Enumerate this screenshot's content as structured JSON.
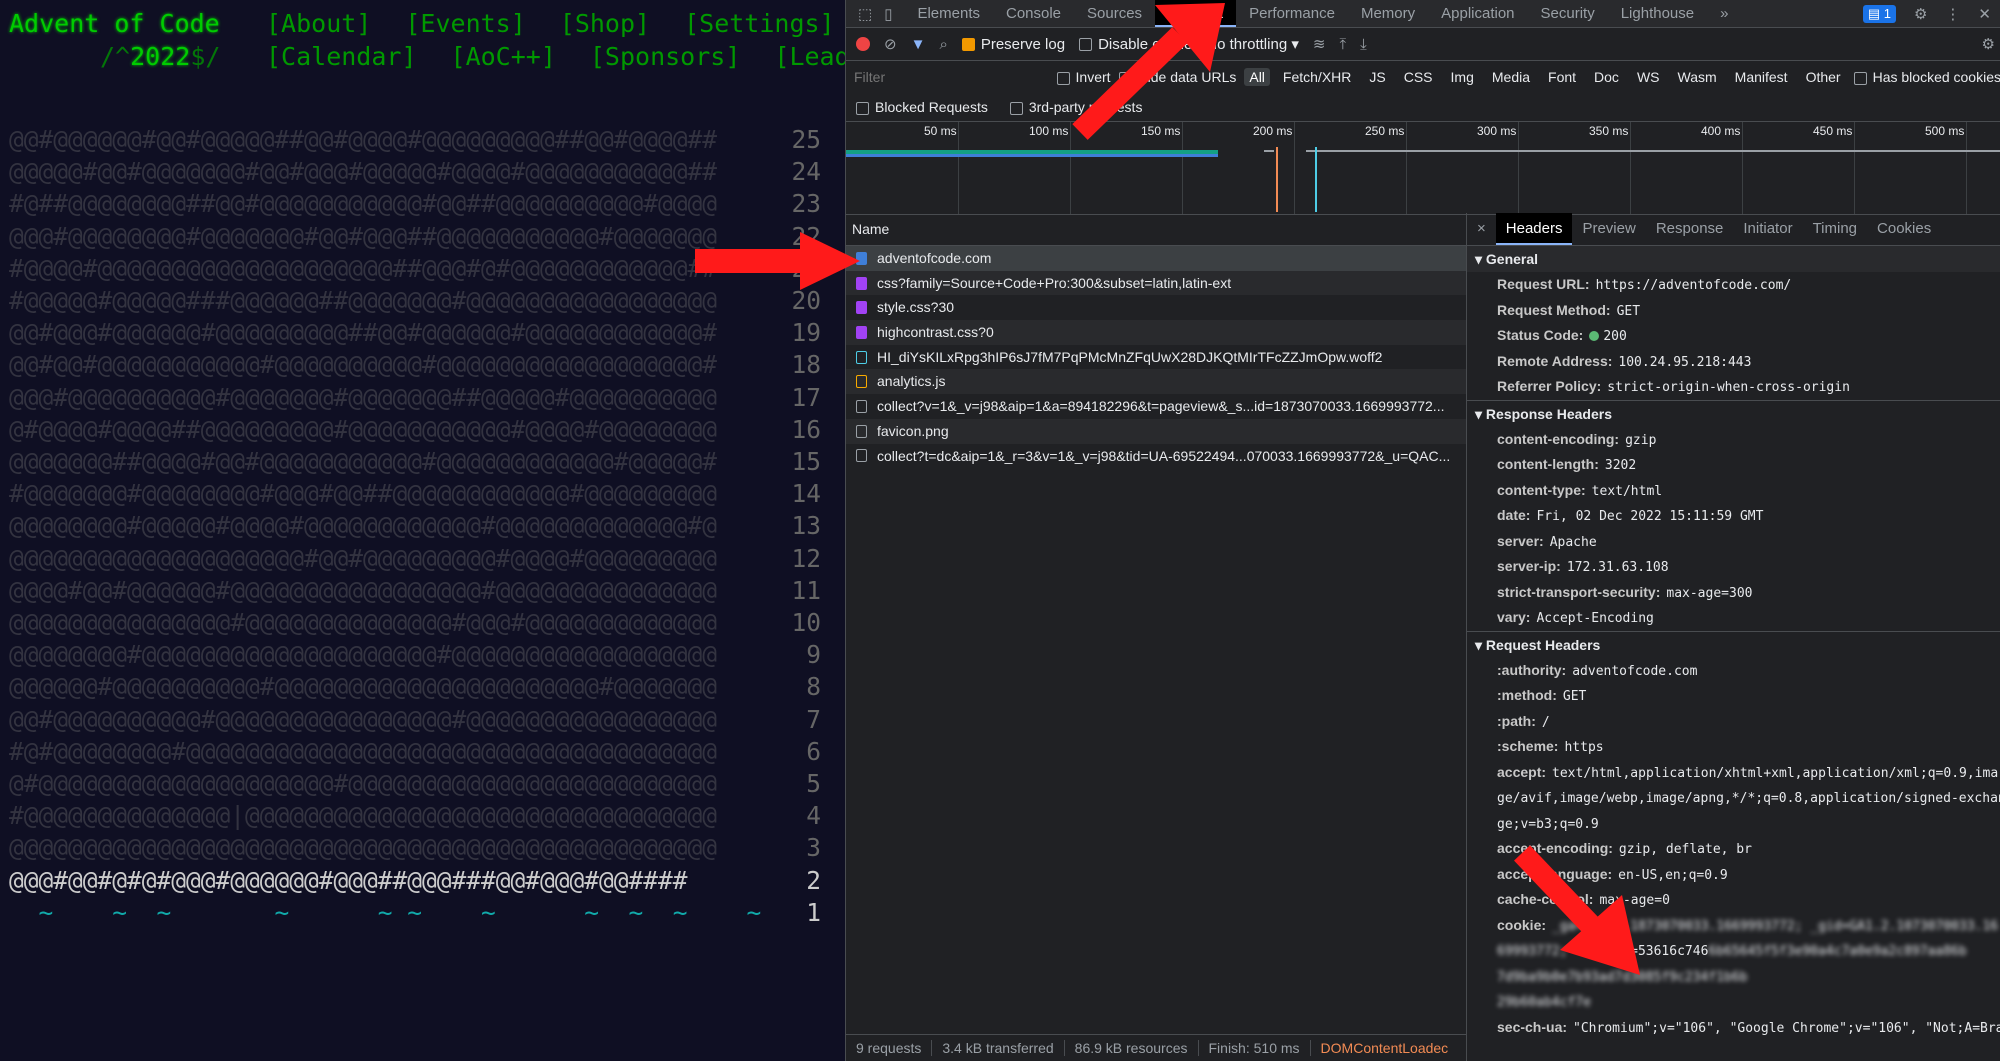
{
  "aoc": {
    "title": "Advent of Code",
    "year_prefix": "/^",
    "year": "2022",
    "year_suffix": "$/",
    "nav_row1": [
      "[About]",
      "[Events]",
      "[Shop]",
      "[Settings]"
    ],
    "nav_row2": [
      "[Calendar]",
      "[AoC++]",
      "[Sponsors]",
      "[Lead"
    ],
    "calendar": [
      {
        "art": "@@#@@@@@@#@@#@@@@@##@@#@@@@#@@@@@@@@@##@@#@@@@##",
        "day": "25",
        "lit": false
      },
      {
        "art": "@@@@@#@@#@@@@@@@#@@#@@@#@@@@@#@@@@#@@@@@@@@@@@##",
        "day": "24",
        "lit": false
      },
      {
        "art": "#@##@@@@@@@@##@@#@@@@@@@@@@@#@@##@@@@@@@@@@#@@@@",
        "day": "23",
        "lit": false
      },
      {
        "art": "@@@#@@@@@@@@#@@@@@@@#@@#@@@##@@@@@@@@@@@#@@@@@@@",
        "day": "22",
        "lit": false
      },
      {
        "art": "#@@@@#@@@@@@@@@@@@@@@@@@@@##@@@#@#@@@@@@@@@@@@##",
        "day": "21",
        "lit": false
      },
      {
        "art": "#@@@@@#@@@@@###@@@@@@##@@@@@@@#@@@@@@@@@@@@@@@@@",
        "day": "20",
        "lit": false
      },
      {
        "art": "@@#@@@#@@@@@@#@@@@@@@@@##@@#@@@@@@#@@@@@@@@@@@@#",
        "day": "19",
        "lit": false
      },
      {
        "art": "@@#@@#@@@@@@@@@@@#@@@@@@@@@@#@@@@@@@@@@@@@@@@@@#",
        "day": "18",
        "lit": false
      },
      {
        "art": "@@@#@@@@@@@@@@#@@@@@@@#@@@@@@@##@@@@@#@@@@@@@@@@",
        "day": "17",
        "lit": false
      },
      {
        "art": "@#@@@@#@@@@##@@@@@@@@@#@@@@@@@@@@@#@@@@#@@@@@@@@",
        "day": "16",
        "lit": false
      },
      {
        "art": "@@@@@@@##@@@@#@@#@@@@@@@@@@@#@@@@@@@@@@@@#@@@@@#",
        "day": "15",
        "lit": false
      },
      {
        "art": "#@@@@@@@#@@@@@@@@#@@@#@@##@@@@@@@@@@@@#@@@@@@@@@",
        "day": "14",
        "lit": false
      },
      {
        "art": "@@@@@@@@#@@@@@#@@@@#@@@@@@@@@@@@#@@@@@@@@@@@@@#@",
        "day": "13",
        "lit": false
      },
      {
        "art": "@@@@@@@@@@@@@@@@@@@@#@@#@@@@@@@@@#@@@@#@@@@@@@@@",
        "day": "12",
        "lit": false
      },
      {
        "art": "@@@@#@@#@@@@@@#@@@@@@@@@@@@@@@@@#@@@@@@@@@@@@@@@",
        "day": "11",
        "lit": false
      },
      {
        "art": "@@@@@@@@@@@@@@@#@@@@@@@@@@@@@@#@@@#@@@@@@@@@@@@@",
        "day": "10",
        "lit": false
      },
      {
        "art": "@@@@@@@@#@@@@@@@@@@@@@@@@@@@@#@@@@@@@@@@@@@@@@@@",
        "day": "9",
        "lit": false
      },
      {
        "art": "@@@@@@#@@@@@@@@@@#@@@@@@@@@@@@@@@@@@@@@@#@@@@@@@",
        "day": "8",
        "lit": false
      },
      {
        "art": "@@#@@@@@@@@@@#@@@@@@@@@@@@@@@@#@@@@@@@@@@@@@@@@@",
        "day": "7",
        "lit": false
      },
      {
        "art": "#@#@@@@@@@@#@@@@@@@@@@@@@@@@@@@@@@@@@@@@@@@@@@@@",
        "day": "6",
        "lit": false
      },
      {
        "art": "@#@@@@@@@@@@@@@@@@@@@@#@@@@@@@@@@@@@@@@@@@@@@@@@",
        "day": "5",
        "lit": false
      },
      {
        "art": "#@@@@@@@@@@@@@@|@@@@@@@@@@@@@@@@@@@@@@@@@@@@@@@@",
        "day": "4",
        "lit": false
      },
      {
        "art": "@@@@@@@@@@@@@@@@@@@@@@@@@@@@@@@@@@@@@@@@@@@@@@@@",
        "day": "3",
        "lit": false
      },
      {
        "art": "@@@#@@#@#@#@@@#@@@@@@#@@@##@@@###@@#@@@#@@####",
        "day": "2",
        "lit": true
      },
      {
        "art": "  ~    ~  ~       ~      ~ ~    ~      ~  ~  ~    ~",
        "day": "1",
        "lit": true,
        "waves": true
      }
    ]
  },
  "devtools": {
    "main_tabs": [
      "Elements",
      "Console",
      "Sources",
      "Network",
      "Performance",
      "Memory",
      "Application",
      "Security",
      "Lighthouse"
    ],
    "active_tab": "Network",
    "more_tabs": "»",
    "issues_count": "1",
    "toolbar": {
      "preserve_log": "Preserve log",
      "disable_cache": "Disable cache",
      "throttling": "No throttling"
    },
    "filter": {
      "placeholder": "Filter",
      "invert": "Invert",
      "hide_data_urls": "Hide data URLs",
      "types": [
        "All",
        "Fetch/XHR",
        "JS",
        "CSS",
        "Img",
        "Media",
        "Font",
        "Doc",
        "WS",
        "Wasm",
        "Manifest",
        "Other"
      ],
      "has_blocked_cookies": "Has blocked cookies",
      "blocked_requests": "Blocked Requests",
      "third_party": "3rd-party requests"
    },
    "timeline_ticks": [
      "50 ms",
      "100 ms",
      "150 ms",
      "200 ms",
      "250 ms",
      "300 ms",
      "350 ms",
      "400 ms",
      "450 ms",
      "500 ms"
    ],
    "list_header": "Name",
    "requests": [
      {
        "name": "adventofcode.com",
        "type": "doc"
      },
      {
        "name": "css?family=Source+Code+Pro:300&subset=latin,latin-ext",
        "type": "css"
      },
      {
        "name": "style.css?30",
        "type": "css"
      },
      {
        "name": "highcontrast.css?0",
        "type": "css"
      },
      {
        "name": "HI_diYsKILxRpg3hIP6sJ7fM7PqPMcMnZFqUwX28DJKQtMIrTFcZZJmOpw.woff2",
        "type": "font"
      },
      {
        "name": "analytics.js",
        "type": "js"
      },
      {
        "name": "collect?v=1&_v=j98&aip=1&a=894182296&t=pageview&_s...id=1873070033.1669993772...",
        "type": "other"
      },
      {
        "name": "favicon.png",
        "type": "other"
      },
      {
        "name": "collect?t=dc&aip=1&_r=3&v=1&_v=j98&tid=UA-69522494...070033.1669993772&_u=QAC...",
        "type": "other"
      }
    ],
    "status": {
      "requests": "9 requests",
      "transferred": "3.4 kB transferred",
      "resources": "86.9 kB resources",
      "finish": "Finish: 510 ms",
      "dcl": "DOMContentLoadec"
    },
    "detail_tabs": [
      "Headers",
      "Preview",
      "Response",
      "Initiator",
      "Timing",
      "Cookies"
    ],
    "detail_close": "×",
    "general": {
      "title": "General",
      "rows": [
        {
          "k": "Request URL:",
          "v": "https://adventofcode.com/"
        },
        {
          "k": "Request Method:",
          "v": "GET"
        },
        {
          "k": "Status Code:",
          "v": "200"
        },
        {
          "k": "Remote Address:",
          "v": "100.24.95.218:443"
        },
        {
          "k": "Referrer Policy:",
          "v": "strict-origin-when-cross-origin"
        }
      ]
    },
    "response_headers": {
      "title": "Response Headers",
      "rows": [
        {
          "k": "content-encoding:",
          "v": "gzip"
        },
        {
          "k": "content-length:",
          "v": "3202"
        },
        {
          "k": "content-type:",
          "v": "text/html"
        },
        {
          "k": "date:",
          "v": "Fri, 02 Dec 2022 15:11:59 GMT"
        },
        {
          "k": "server:",
          "v": "Apache"
        },
        {
          "k": "server-ip:",
          "v": "172.31.63.108"
        },
        {
          "k": "strict-transport-security:",
          "v": "max-age=300"
        },
        {
          "k": "vary:",
          "v": "Accept-Encoding"
        }
      ]
    },
    "request_headers": {
      "title": "Request Headers",
      "rows": [
        {
          "k": ":authority:",
          "v": "adventofcode.com"
        },
        {
          "k": ":method:",
          "v": "GET"
        },
        {
          "k": ":path:",
          "v": "/"
        },
        {
          "k": ":scheme:",
          "v": "https"
        },
        {
          "k": "accept:",
          "v": "text/html,application/xhtml+xml,application/xml;q=0.9,ima"
        },
        {
          "k": "",
          "v": "ge/avif,image/webp,image/apng,*/*;q=0.8,application/signed-exchan"
        },
        {
          "k": "",
          "v": "ge;v=b3;q=0.9"
        },
        {
          "k": "accept-encoding:",
          "v": "gzip, deflate, br"
        },
        {
          "k": "accept-language:",
          "v": "en-US,en;q=0.9"
        },
        {
          "k": "cache-control:",
          "v": "max-age=0"
        }
      ],
      "cookie_key": "cookie:",
      "session_value": "session=53616c746",
      "sec_ch_ua_key": "sec-ch-ua:",
      "sec_ch_ua_value": "\"Chromium\";v=\"106\", \"Google Chrome\";v=\"106\", \"Not;A=Bra"
    }
  }
}
